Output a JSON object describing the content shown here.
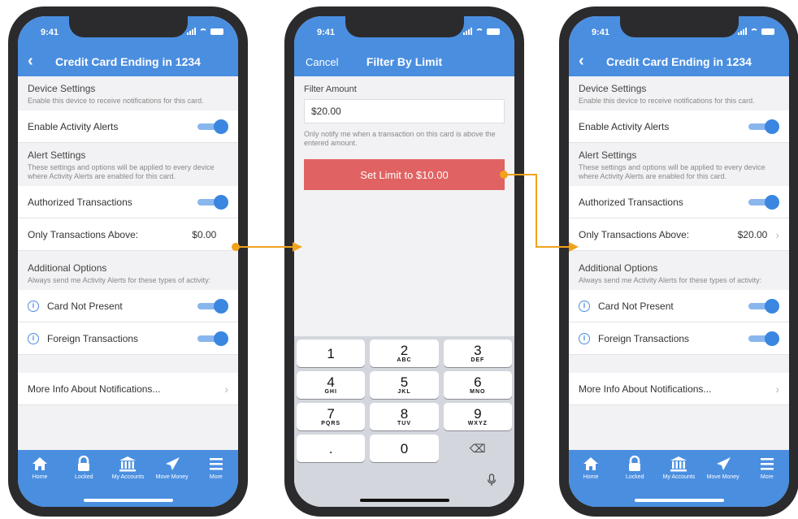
{
  "status": {
    "time": "9:41"
  },
  "colors": {
    "primary": "#4a8ee0",
    "danger": "#e06262",
    "arrow": "#f0a21a"
  },
  "settings_screen": {
    "title": "Credit Card Ending in 1234",
    "device_settings": {
      "title": "Device Settings",
      "desc": "Enable this device to receive notifications for this card."
    },
    "enable_alerts_label": "Enable Activity Alerts",
    "alert_settings": {
      "title": "Alert Settings",
      "desc": "These settings and options will be applied to every device where Activity Alerts are enabled for this card."
    },
    "authorized_label": "Authorized Transactions",
    "above_label": "Only Transactions Above:",
    "additional": {
      "title": "Additional Options",
      "desc": "Always send me Activity Alerts for these types of activity:"
    },
    "card_not_present": "Card Not Present",
    "foreign": "Foreign Transactions",
    "more_info": "More Info About Notifications...",
    "info_glyph": "i",
    "chevron": "›"
  },
  "screen1": {
    "above_value": "$0.00"
  },
  "screen3": {
    "above_value": "$20.00"
  },
  "filter_screen": {
    "cancel": "Cancel",
    "title": "Filter By Limit",
    "amount_label": "Filter Amount",
    "amount_value": "$20.00",
    "note": "Only notify me when a transaction on this card is above the entered amount.",
    "button": "Set Limit to $10.00"
  },
  "keypad": [
    [
      {
        "d": "1",
        "l": ""
      },
      {
        "d": "2",
        "l": "ABC"
      },
      {
        "d": "3",
        "l": "DEF"
      }
    ],
    [
      {
        "d": "4",
        "l": "GHI"
      },
      {
        "d": "5",
        "l": "JKL"
      },
      {
        "d": "6",
        "l": "MNO"
      }
    ],
    [
      {
        "d": "7",
        "l": "PQRS"
      },
      {
        "d": "8",
        "l": "TUV"
      },
      {
        "d": "9",
        "l": "WXYZ"
      }
    ],
    [
      {
        "d": ".",
        "l": ""
      },
      {
        "d": "0",
        "l": ""
      },
      {
        "d": "⌫",
        "l": ""
      }
    ]
  ],
  "tabs": [
    {
      "label": "Home",
      "icon": "home-icon"
    },
    {
      "label": "Locked",
      "icon": "lock-icon"
    },
    {
      "label": "My Accounts",
      "icon": "bank-icon"
    },
    {
      "label": "Move Money",
      "icon": "paper-plane-icon"
    },
    {
      "label": "More",
      "icon": "menu-icon"
    }
  ]
}
